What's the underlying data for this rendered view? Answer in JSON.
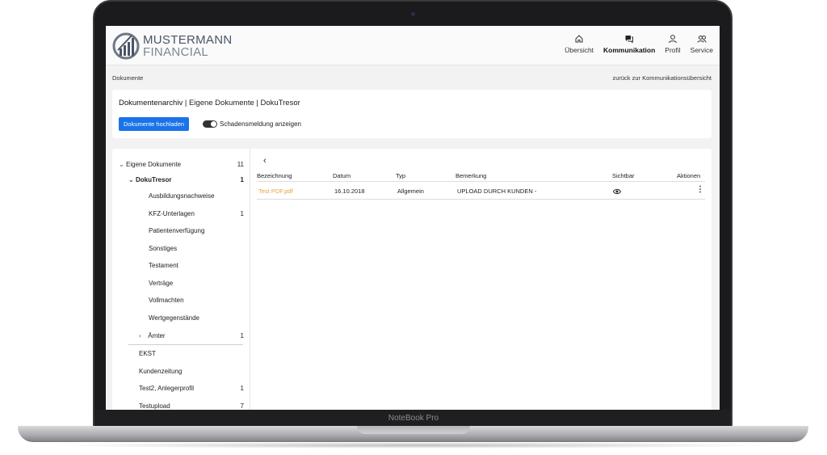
{
  "device": {
    "label": "NoteBook Pro"
  },
  "logo": {
    "line1": "MUSTERMANN",
    "line2": "FINANCIAL"
  },
  "nav": [
    {
      "label": "Übersicht",
      "icon": "home-icon"
    },
    {
      "label": "Kommunikation",
      "icon": "chat-icon",
      "active": true
    },
    {
      "label": "Profil",
      "icon": "user-icon"
    },
    {
      "label": "Service",
      "icon": "users-icon"
    }
  ],
  "breadcrumb": {
    "current": "Dokumente",
    "back_link": "zurück zur Kommunikationsübersicht"
  },
  "header_card": {
    "title_main": "Dokumentenarchiv",
    "title_rest": " | Eigene Dokumente | DokuTresor",
    "upload_button": "Dokumente hochladen",
    "toggle_label": "Schadensmeldung anzeigen",
    "toggle_on": true
  },
  "tree": [
    {
      "label": "Eigene Dokumente",
      "count": "11",
      "level": 0,
      "expanded": true
    },
    {
      "label": "DokuTresor",
      "count": "1",
      "level": 1,
      "expanded": true,
      "bold": true
    },
    {
      "label": "Ausbildungsnachweise",
      "count": "",
      "level": 2
    },
    {
      "label": "KFZ-Unterlagen",
      "count": "1",
      "level": 2
    },
    {
      "label": "Patientenverfügung",
      "count": "",
      "level": 2
    },
    {
      "label": "Sonstiges",
      "count": "",
      "level": 2
    },
    {
      "label": "Testament",
      "count": "",
      "level": 2
    },
    {
      "label": "Verträge",
      "count": "",
      "level": 2
    },
    {
      "label": "Vollmachten",
      "count": "",
      "level": 2
    },
    {
      "label": "Wertgegenstände",
      "count": "",
      "level": 2
    },
    {
      "label": "Ämter",
      "count": "1",
      "level": 2,
      "collapsed": true
    },
    {
      "label": "EKST",
      "count": "",
      "level": 1
    },
    {
      "label": "Kundenzeitung",
      "count": "",
      "level": 1
    },
    {
      "label": "Test2, Anlegerprofil",
      "count": "1",
      "level": 1
    },
    {
      "label": "Testupload",
      "count": "7",
      "level": 1
    }
  ],
  "table": {
    "headers": [
      "Bezeichnung",
      "Datum",
      "Typ",
      "Bemerkung",
      "Sichtbar",
      "Aktionen"
    ],
    "rows": [
      {
        "name": "Test PDF.pdf",
        "date": "16.10.2018",
        "type": "Allgemein",
        "remark": "UPLOAD DURCH KUNDEN -",
        "visible_icon": "eye-icon",
        "actions_icon": "more-vertical-icon"
      }
    ]
  },
  "colors": {
    "primary": "#1a73e8",
    "file_link": "#e8a33c"
  }
}
